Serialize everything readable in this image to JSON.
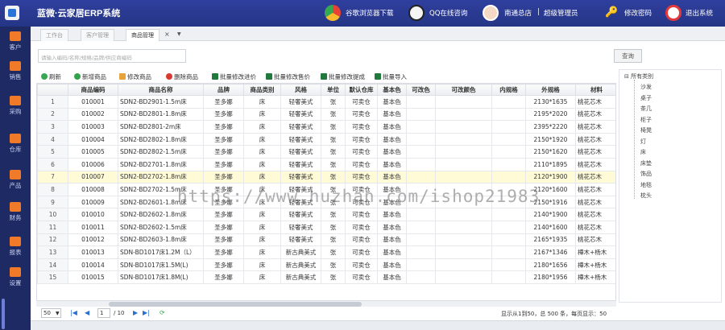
{
  "header": {
    "title": "蓝微·云家居ERP系统",
    "links": [
      "谷歌浏览器下载",
      "QQ在线咨询",
      "南通总店",
      "超级管理员",
      "修改密码",
      "退出系统"
    ],
    "separator": "|"
  },
  "sidebar": {
    "items": [
      "客户",
      "销售",
      "采购",
      "仓库",
      "产品",
      "财务",
      "报表",
      "设置"
    ]
  },
  "tabs": [
    "工作台",
    "客户管理",
    "商品管理"
  ],
  "search": {
    "placeholder": "请输入编码/名称/规格/品牌/供应商编码",
    "button": "查询"
  },
  "toolbar": [
    "刷新",
    "新增商品",
    "修改商品",
    "删除商品",
    "批量修改进价",
    "批量修改售价",
    "批量修改提成",
    "批量导入"
  ],
  "table": {
    "columns": [
      "",
      "商品编码",
      "商品名称",
      "品牌",
      "商品类别",
      "风格",
      "单位",
      "默认仓库",
      "基本色",
      "可改色",
      "可改颜色",
      "内规格",
      "外规格",
      "材料"
    ],
    "rows": [
      [
        "1",
        "010001",
        "SDN2-BD2901-1.5m床",
        "圣多娜",
        "床",
        "轻奢美式",
        "张",
        "可卖仓",
        "基本色",
        "",
        "",
        "",
        "2130*1635",
        "桃花芯木"
      ],
      [
        "2",
        "010002",
        "SDN2-BD2801-1.8m床",
        "圣多娜",
        "床",
        "轻奢美式",
        "张",
        "可卖仓",
        "基本色",
        "",
        "",
        "",
        "2195*2020",
        "桃花芯木"
      ],
      [
        "3",
        "010003",
        "SDN2-BD2801-2m床",
        "圣多娜",
        "床",
        "轻奢美式",
        "张",
        "可卖仓",
        "基本色",
        "",
        "",
        "",
        "2395*2220",
        "桃花芯木"
      ],
      [
        "4",
        "010004",
        "SDN2-BD2802-1.8m床",
        "圣多娜",
        "床",
        "轻奢美式",
        "张",
        "可卖仓",
        "基本色",
        "",
        "",
        "",
        "2150*1920",
        "桃花芯木"
      ],
      [
        "5",
        "010005",
        "SDN2-BD2802-1.5m床",
        "圣多娜",
        "床",
        "轻奢美式",
        "张",
        "可卖仓",
        "基本色",
        "",
        "",
        "",
        "2150*1620",
        "桃花芯木"
      ],
      [
        "6",
        "010006",
        "SDN2-BD2701-1.8m床",
        "圣多娜",
        "床",
        "轻奢美式",
        "张",
        "可卖仓",
        "基本色",
        "",
        "",
        "",
        "2110*1895",
        "桃花芯木"
      ],
      [
        "7",
        "010007",
        "SDN2-BD2702-1.8m床",
        "圣多娜",
        "床",
        "轻奢美式",
        "张",
        "可卖仓",
        "基本色",
        "",
        "",
        "",
        "2120*1900",
        "桃花芯木"
      ],
      [
        "8",
        "010008",
        "SDN2-BD2702-1.5m床",
        "圣多娜",
        "床",
        "轻奢美式",
        "张",
        "可卖仓",
        "基本色",
        "",
        "",
        "",
        "2120*1600",
        "桃花芯木"
      ],
      [
        "9",
        "010009",
        "SDN2-BD2601-1.8m床",
        "圣多娜",
        "床",
        "轻奢美式",
        "张",
        "可卖仓",
        "基本色",
        "",
        "",
        "",
        "2150*1916",
        "桃花芯木"
      ],
      [
        "10",
        "010010",
        "SDN2-BD2602-1.8m床",
        "圣多娜",
        "床",
        "轻奢美式",
        "张",
        "可卖仓",
        "基本色",
        "",
        "",
        "",
        "2140*1900",
        "桃花芯木"
      ],
      [
        "11",
        "010011",
        "SDN2-BD2602-1.5m床",
        "圣多娜",
        "床",
        "轻奢美式",
        "张",
        "可卖仓",
        "基本色",
        "",
        "",
        "",
        "2140*1600",
        "桃花芯木"
      ],
      [
        "12",
        "010012",
        "SDN2-BD2603-1.8m床",
        "圣多娜",
        "床",
        "轻奢美式",
        "张",
        "可卖仓",
        "基本色",
        "",
        "",
        "",
        "2165*1935",
        "桃花芯木"
      ],
      [
        "13",
        "010013",
        "SDN-BD1017床1.2M（L）",
        "圣多娜",
        "床",
        "新古典美式",
        "张",
        "可卖仓",
        "基本色",
        "",
        "",
        "",
        "2167*1346",
        "樺木+杨木"
      ],
      [
        "14",
        "010014",
        "SDN-BD1017床1.5M(L)",
        "圣多娜",
        "床",
        "新古典美式",
        "张",
        "可卖仓",
        "基本色",
        "",
        "",
        "",
        "2180*1656",
        "樺木+杨木"
      ],
      [
        "15",
        "010015",
        "SDN-BD1017床1.8M(L)",
        "圣多娜",
        "床",
        "新古典美式",
        "张",
        "可卖仓",
        "基本色",
        "",
        "",
        "",
        "2180*1956",
        "樺木+杨木"
      ]
    ],
    "selected_row": 7
  },
  "pager": {
    "page_size": "50",
    "current_page": "1",
    "total_pages": "/ 10",
    "summary": "显示从1到50，总 500 条，每页显示：50"
  },
  "tree": {
    "root": "所有类别",
    "children": [
      "沙发",
      "桌子",
      "茶几",
      "柜子",
      "椅凳",
      "灯",
      "床",
      "床垫",
      "饰品",
      "地毯",
      "枕头"
    ]
  },
  "watermark": "https://www.huzhan.com/ishop21983",
  "colors": {
    "topbar": "#2a3a94",
    "sidebar": "#1e2a63",
    "selected_row": "#fffbd7",
    "accent": "#f07a28"
  }
}
